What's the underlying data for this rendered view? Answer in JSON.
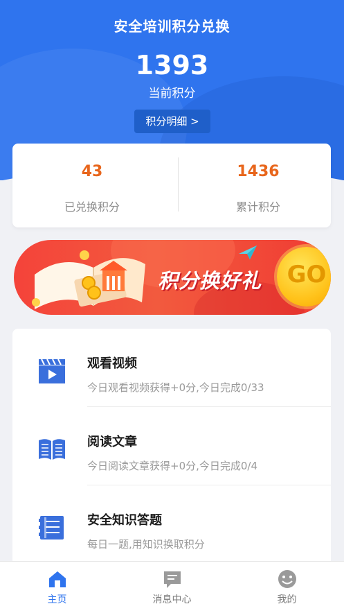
{
  "header": {
    "title": "安全培训积分兑换",
    "current_points": "1393",
    "current_points_label": "当前积分",
    "detail_button": "积分明细 >"
  },
  "stats": {
    "exchanged": {
      "value": "43",
      "label": "已兑换积分"
    },
    "total": {
      "value": "1436",
      "label": "累计积分"
    }
  },
  "banner": {
    "slogan": "积分换好礼",
    "go_label": "GO"
  },
  "tasks": [
    {
      "name": "观看视频",
      "desc": "今日观看视频获得+0分,今日完成0/33",
      "icon": "video-icon"
    },
    {
      "name": "阅读文章",
      "desc": "今日阅读文章获得+0分,今日完成0/4",
      "icon": "book-icon"
    },
    {
      "name": "安全知识答题",
      "desc": "每日一题,用知识换取积分",
      "icon": "quiz-icon"
    }
  ],
  "tabbar": [
    {
      "label": "主页",
      "icon": "home-icon",
      "active": true
    },
    {
      "label": "消息中心",
      "icon": "message-icon",
      "active": false
    },
    {
      "label": "我的",
      "icon": "profile-icon",
      "active": false
    }
  ],
  "colors": {
    "primary": "#2f74ee",
    "accent_orange": "#e8661c",
    "banner_red": "#f4433a",
    "go_yellow": "#ffc21a"
  }
}
